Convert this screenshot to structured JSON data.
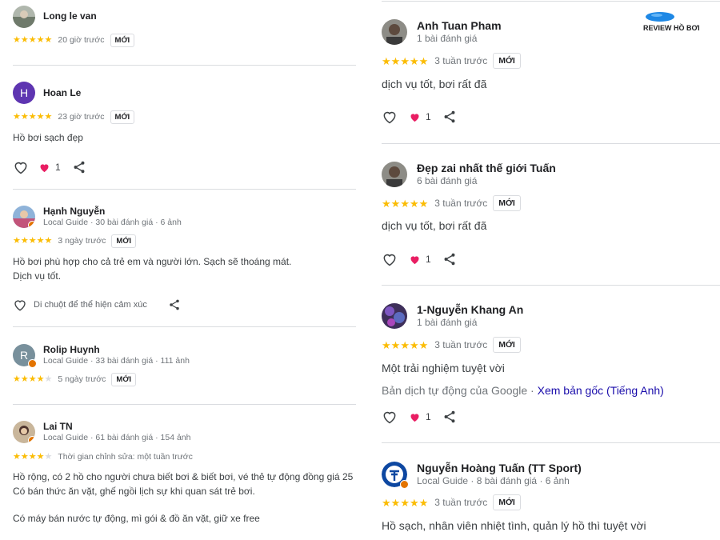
{
  "logo": {
    "text": "REVIEW HỒ BƠI"
  },
  "new_label": "MỚI",
  "left_reviews": [
    {
      "name": "Long le van",
      "meta": "",
      "rating": 5,
      "when": "20 giờ trước",
      "new": true,
      "text": [],
      "likes": "",
      "hint": ""
    },
    {
      "name": "Hoan Le",
      "initial": "H",
      "meta": "",
      "rating": 5,
      "when": "23 giờ trước",
      "new": true,
      "text": [
        "Hồ bơi sạch đẹp"
      ],
      "likes": "1",
      "hint": ""
    },
    {
      "name": "Hạnh Nguyễn",
      "meta": "Local Guide · 30 bài đánh giá · 6 ảnh",
      "rating": 5,
      "when": "3 ngày trước",
      "new": true,
      "text": [
        "Hồ bơi phù hợp cho cả trẻ em và người lớn. Sạch sẽ thoáng mát.",
        "Dịch vụ tốt."
      ],
      "likes": "",
      "hint": "Di chuột để thể hiện cảm xúc"
    },
    {
      "name": "Rolip Huynh",
      "initial": "R",
      "meta": "Local Guide · 33 bài đánh giá · 111 ảnh",
      "rating": 4,
      "when": "5 ngày trước",
      "new": true,
      "text": [],
      "likes": "",
      "hint": ""
    },
    {
      "name": "Lai TN",
      "meta": "Local Guide · 61 bài đánh giá · 154 ảnh",
      "rating": 4,
      "when": "Thời gian chỉnh sửa: một tuần trước",
      "new": false,
      "text": [
        "Hồ rộng, có 2 hồ cho người chưa biết bơi & biết bơi, vé thẻ tự động đồng giá 25",
        "Có bán thức ăn vặt, ghế ngồi lịch sự khi quan sát trẻ bơi.",
        "",
        "Có máy bán nước tự động, mì gói & đồ ăn vặt, giữ xe free"
      ],
      "likes": "",
      "hint": ""
    }
  ],
  "right_reviews": [
    {
      "name": "Anh Tuan Pham",
      "meta": "1 bài đánh giá",
      "rating": 5,
      "when": "3 tuần trước",
      "new": true,
      "text": "dịch vụ tốt, bơi rất đã",
      "likes": "1"
    },
    {
      "name": "Đẹp zai nhất thế giới Tuấn",
      "meta": "6 bài đánh giá",
      "rating": 5,
      "when": "3 tuần trước",
      "new": true,
      "text": "dịch vụ tốt, bơi rất đã",
      "likes": "1"
    },
    {
      "name": "1-Nguyễn Khang An",
      "meta": "1 bài đánh giá",
      "rating": 5,
      "when": "3 tuần trước",
      "new": true,
      "text": "Một trải nghiệm tuyệt vời",
      "translate_note": "Bản dịch tự động của Google · ",
      "translate_link": "Xem bản gốc (Tiếng Anh)",
      "likes": "1"
    },
    {
      "name": "Nguyễn Hoàng Tuấn (TT Sport)",
      "meta": "Local Guide · 8 bài đánh giá · 6 ảnh",
      "rating": 5,
      "when": "3 tuần trước",
      "new": true,
      "text": "Hồ sạch, nhân viên nhiệt tình, quản lý hồ thì tuyệt vời",
      "likes": ""
    }
  ],
  "colors": {
    "star": "#fbbc04",
    "heart": "#e91e63",
    "divider": "#dadce0",
    "link": "#1a0dab",
    "logo_blue": "#1e88e5"
  }
}
